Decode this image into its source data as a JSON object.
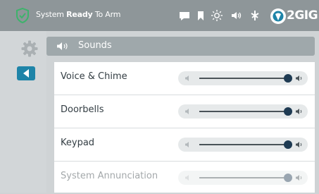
{
  "status": {
    "prefix": "System",
    "state": "Ready",
    "suffix": "To Arm"
  },
  "brand": {
    "name": "2GIG"
  },
  "tray_icons": [
    "message-icon",
    "bookmark-icon",
    "brightness-icon",
    "volume-icon",
    "z-wave-icon"
  ],
  "sidebar": {
    "settings_icon": "gear-icon",
    "back_icon": "back-arrow-icon"
  },
  "header": {
    "title": "Sounds",
    "icon": "speaker-icon"
  },
  "colors": {
    "topbar": "#8e9699",
    "accent": "#1e84a8",
    "shield": "#3db36b",
    "knob": "#1e3a52"
  },
  "settings": [
    {
      "label": "Voice & Chime",
      "level": 1.0,
      "enabled": true
    },
    {
      "label": "Doorbells",
      "level": 1.0,
      "enabled": true
    },
    {
      "label": "Keypad",
      "level": 1.0,
      "enabled": true
    },
    {
      "label": "System Annunciation",
      "level": 1.0,
      "enabled": false
    }
  ]
}
